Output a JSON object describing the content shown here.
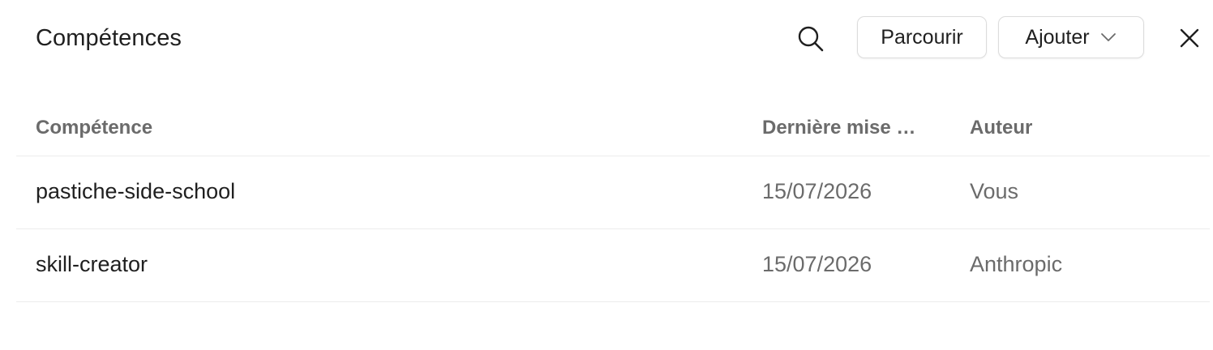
{
  "header": {
    "title": "Compétences",
    "search_icon": "search-icon",
    "browse_label": "Parcourir",
    "add_label": "Ajouter",
    "add_icon": "chevron-down-icon",
    "close_icon": "close-icon"
  },
  "table": {
    "columns": [
      "Compétence",
      "Dernière mise …",
      "Auteur"
    ],
    "rows": [
      {
        "skill": "pastiche-side-school",
        "updated": "15/07/2026",
        "author": "Vous"
      },
      {
        "skill": "skill-creator",
        "updated": "15/07/2026",
        "author": "Anthropic"
      }
    ]
  },
  "colors": {
    "text": "#1f1f1f",
    "muted": "#6b6b6b",
    "border": "#dcdcdc",
    "divider": "#ececec"
  }
}
